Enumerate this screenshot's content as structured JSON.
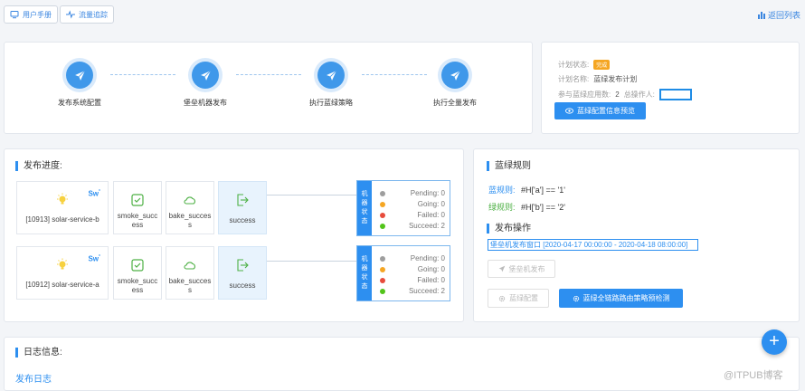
{
  "toolbar": {
    "manual_label": "用户手册",
    "traffic_label": "流量追踪",
    "back_label": "返回列表"
  },
  "pipeline": {
    "steps": [
      {
        "label": "发布系统配置"
      },
      {
        "label": "堡垒机器发布"
      },
      {
        "label": "执行蓝绿策略"
      },
      {
        "label": "执行全量发布"
      }
    ]
  },
  "plan": {
    "status_key": "计划状态:",
    "status_value": "完成",
    "name_key": "计划名称:",
    "name_value": "蓝绿发布计划",
    "apps_key": "参与蓝绿应用数:",
    "apps_value": "2",
    "operator_key": "总操作人:",
    "preview_button": "蓝绿配置信息预览"
  },
  "progress": {
    "title": "发布进度:",
    "rows": [
      {
        "app": "[10913] solar-service-b",
        "sw": "Sw",
        "smoke": "smoke_success",
        "bake": "bake_success",
        "result": "success",
        "machine_label": [
          "机",
          "器",
          "状",
          "态"
        ],
        "stats": [
          {
            "text": "Pending: 0",
            "color": "#9e9e9e"
          },
          {
            "text": "Going: 0",
            "color": "#f5a623"
          },
          {
            "text": "Failed: 0",
            "color": "#e74c3c"
          },
          {
            "text": "Succeed: 2",
            "color": "#52c41a"
          }
        ]
      },
      {
        "app": "[10912] solar-service-a",
        "sw": "Sw",
        "smoke": "smoke_success",
        "bake": "bake_success",
        "result": "success",
        "machine_label": [
          "机",
          "器",
          "状",
          "态"
        ],
        "stats": [
          {
            "text": "Pending: 0",
            "color": "#9e9e9e"
          },
          {
            "text": "Going: 0",
            "color": "#f5a623"
          },
          {
            "text": "Failed: 0",
            "color": "#e74c3c"
          },
          {
            "text": "Succeed: 2",
            "color": "#52c41a"
          }
        ]
      }
    ]
  },
  "rules": {
    "title": "蓝绿规则",
    "blue_key": "蓝规则:",
    "blue_value": "#H['a'] == '1'",
    "green_key": "绿规则:",
    "green_value": "#H['b'] == '2'"
  },
  "ops": {
    "title": "发布操作",
    "window": "堡垒机发布窗口 [2020-04-17 00:00:00 - 2020-04-18 08:00:00]",
    "bastion_button": "堡垒机发布",
    "config_button": "蓝绿配置",
    "detect_button": "蓝绿全链路路由策略预检测"
  },
  "log": {
    "title": "日志信息:",
    "link": "发布日志"
  },
  "fab": "+",
  "watermark": "@ITPUB博客"
}
